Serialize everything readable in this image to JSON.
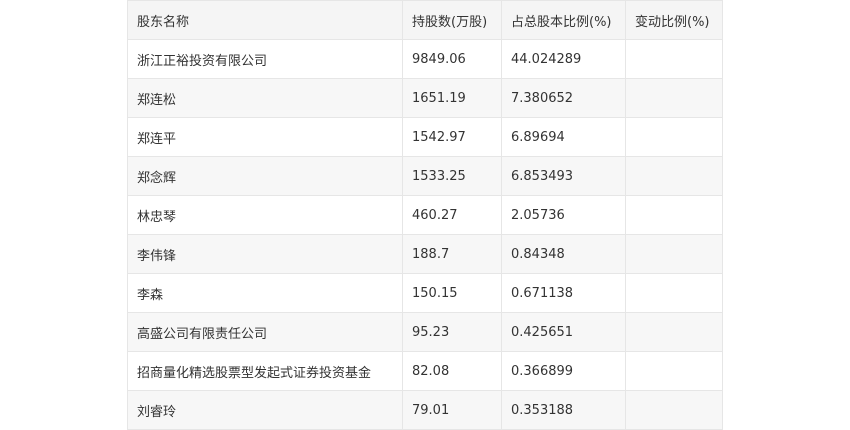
{
  "table": {
    "headers": [
      "股东名称",
      "持股数(万股)",
      "占总股本比例(%)",
      "变动比例(%)"
    ],
    "rows": [
      {
        "name": "浙江正裕投资有限公司",
        "shares": "9849.06",
        "ratio": "44.024289",
        "change": ""
      },
      {
        "name": "郑连松",
        "shares": "1651.19",
        "ratio": "7.380652",
        "change": ""
      },
      {
        "name": "郑连平",
        "shares": "1542.97",
        "ratio": "6.89694",
        "change": ""
      },
      {
        "name": "郑念辉",
        "shares": "1533.25",
        "ratio": "6.853493",
        "change": ""
      },
      {
        "name": "林忠琴",
        "shares": "460.27",
        "ratio": "2.05736",
        "change": ""
      },
      {
        "name": "李伟锋",
        "shares": "188.7",
        "ratio": "0.84348",
        "change": ""
      },
      {
        "name": "李森",
        "shares": "150.15",
        "ratio": "0.671138",
        "change": ""
      },
      {
        "name": "高盛公司有限责任公司",
        "shares": "95.23",
        "ratio": "0.425651",
        "change": ""
      },
      {
        "name": "招商量化精选股票型发起式证券投资基金",
        "shares": "82.08",
        "ratio": "0.366899",
        "change": ""
      },
      {
        "name": "刘睿玲",
        "shares": "79.01",
        "ratio": "0.353188",
        "change": ""
      }
    ]
  }
}
